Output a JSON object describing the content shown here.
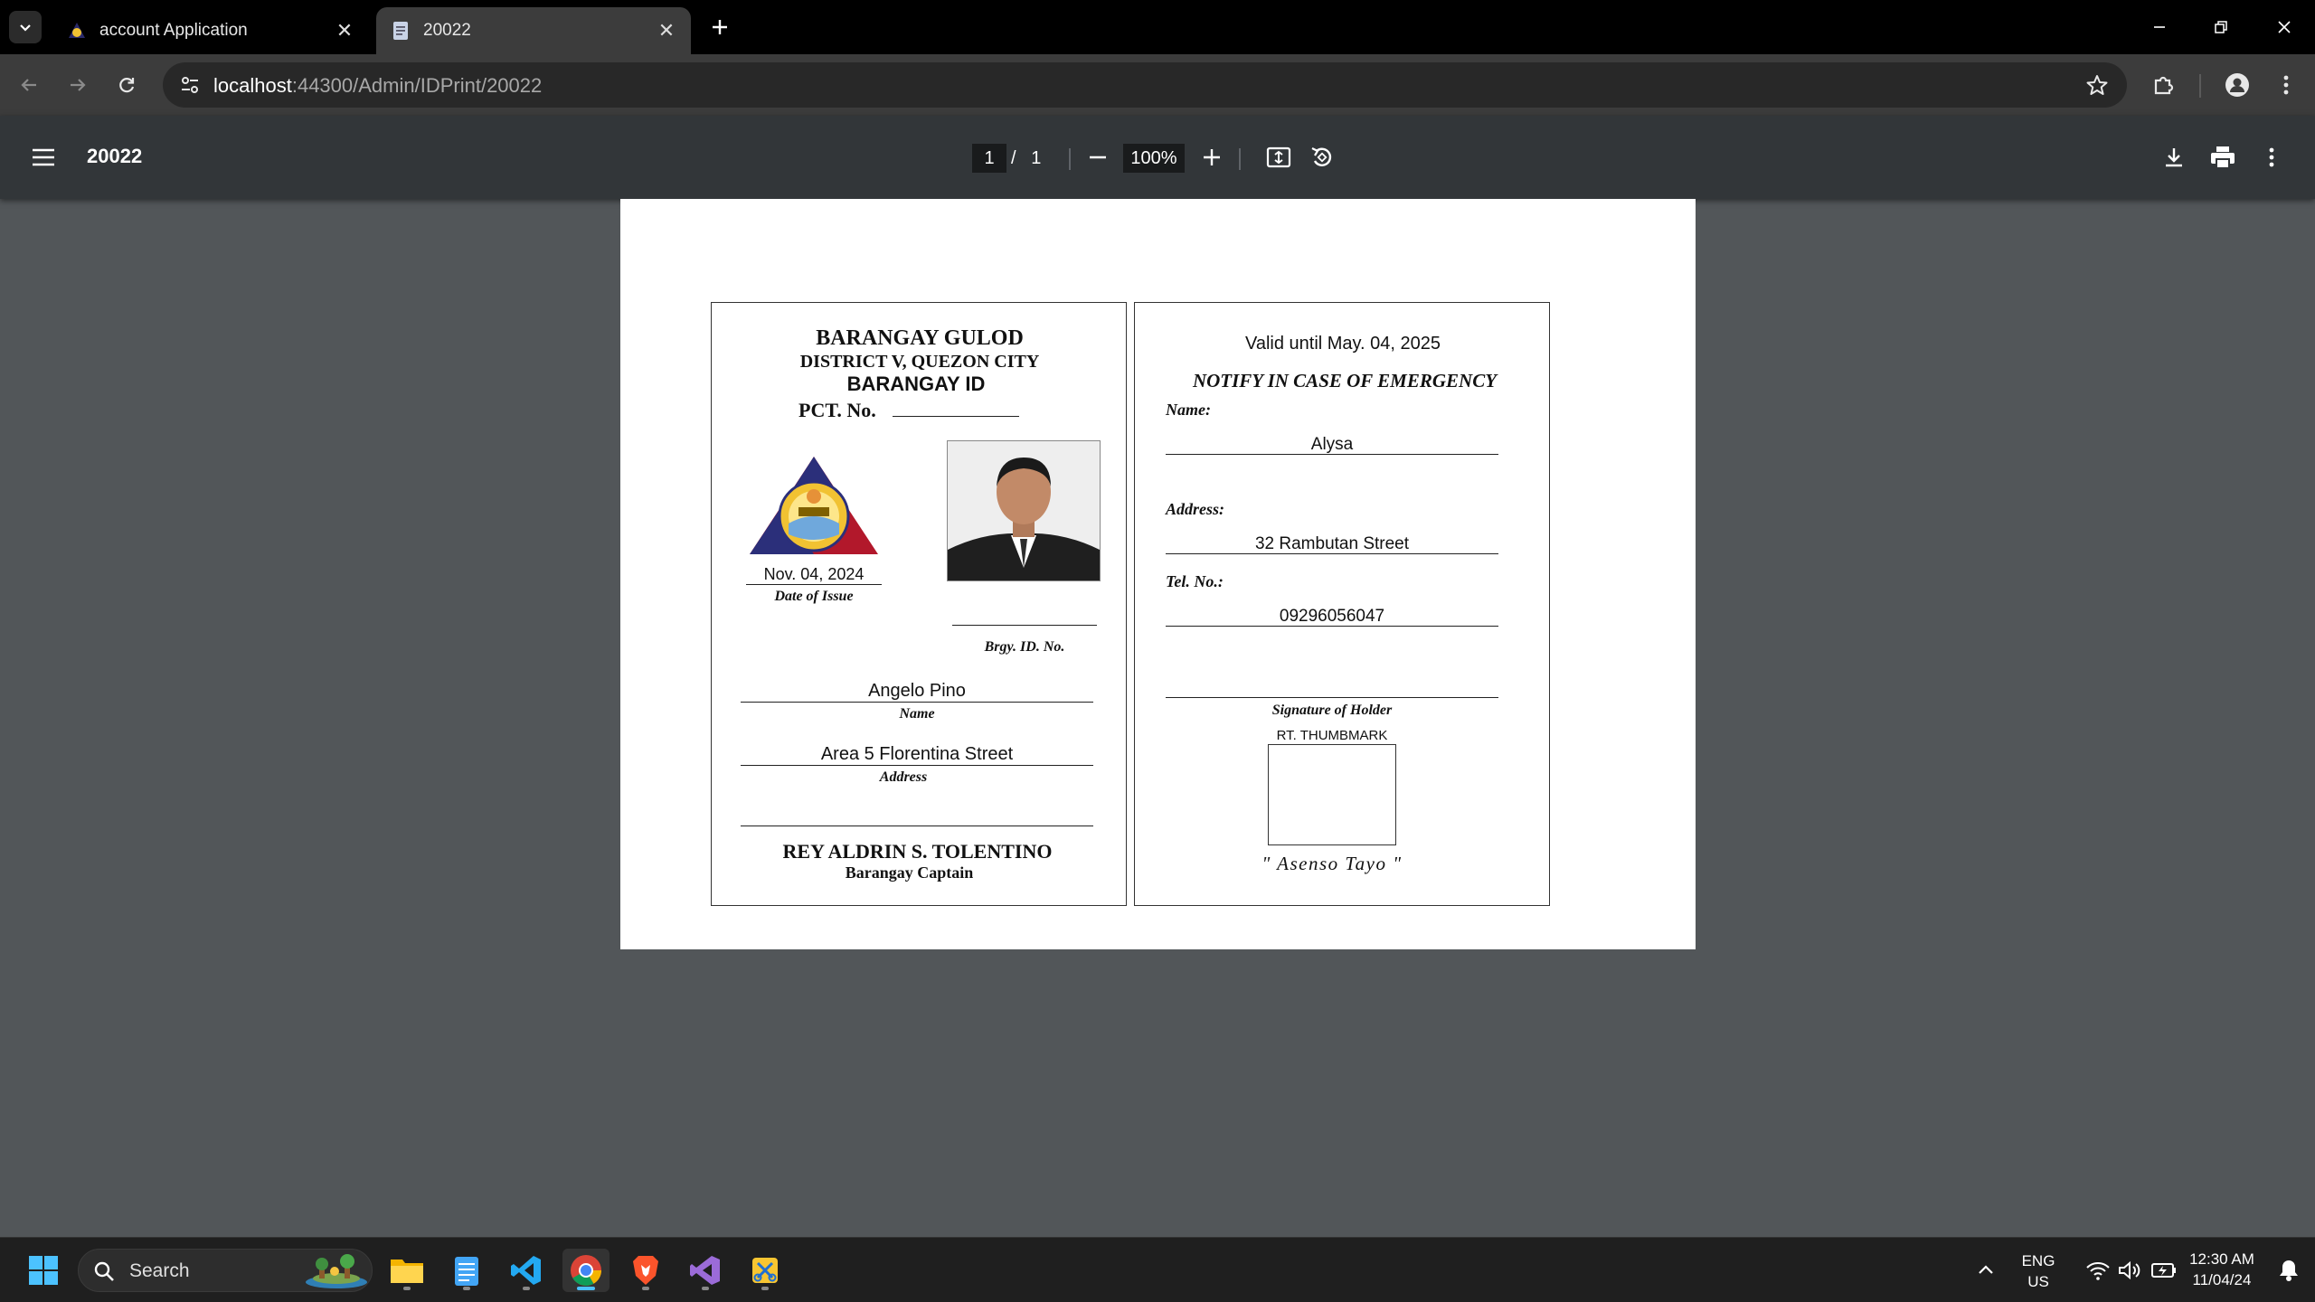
{
  "browser": {
    "tabs": [
      {
        "title": "account Application",
        "active": false
      },
      {
        "title": "20022",
        "active": true
      }
    ],
    "url_host": "localhost",
    "url_rest": ":44300/Admin/IDPrint/20022"
  },
  "pdf_viewer": {
    "title": "20022",
    "current_page": "1",
    "page_separator": "/",
    "total_pages": "1",
    "zoom": "100%"
  },
  "id_front": {
    "barangay": "BARANGAY GULOD",
    "district": "DISTRICT V, QUEZON CITY",
    "id_title": "BARANGAY ID",
    "pct_label": "PCT. No.",
    "date_value": "Nov. 04, 2024",
    "date_label": "Date of Issue",
    "brgy_id_label": "Brgy. ID. No.",
    "name_value": "Angelo Pino",
    "name_label": "Name",
    "address_value": "Area 5 Florentina Street",
    "address_label": "Address",
    "captain_name": "REY ALDRIN S. TOLENTINO",
    "captain_title": "Barangay Captain"
  },
  "id_back": {
    "valid_until": "Valid until May. 04, 2025",
    "notify_heading": "NOTIFY IN CASE OF EMERGENCY",
    "name_label": "Name:",
    "name_value": "Alysa",
    "address_label": "Address:",
    "address_value": "32 Rambutan Street",
    "tel_label": "Tel. No.:",
    "tel_value": "09296056047",
    "signature_label": "Signature of Holder",
    "thumbmark_label": "RT. THUMBMARK",
    "motto": "\" Asenso Tayo \""
  },
  "taskbar": {
    "search_label": "Search",
    "lang_line1": "ENG",
    "lang_line2": "US",
    "time": "12:30 AM",
    "date": "11/04/24"
  },
  "colors": {
    "chrome_dark": "#000000",
    "toolbar": "#3c3c3c",
    "pdf_toolbar": "#323639",
    "pdf_background": "#525659",
    "taskbar": "#1f1f1f",
    "accent": "#4cc2ff"
  }
}
